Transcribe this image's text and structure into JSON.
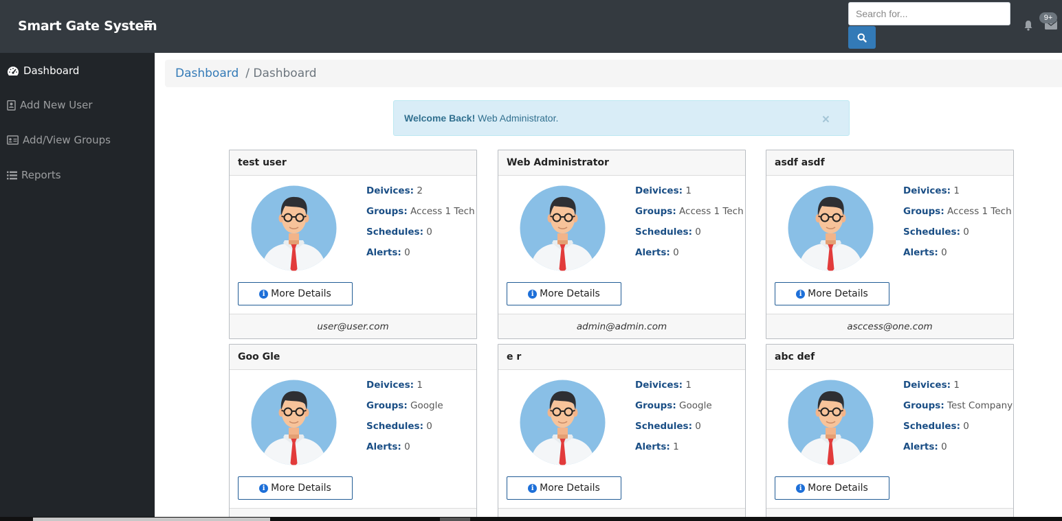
{
  "app": {
    "brand": "Smart Gate System",
    "menu_icon": "bars-icon"
  },
  "topbar": {
    "search_placeholder": "Search for...",
    "search_icon": "search-icon",
    "notification_icon": "bell-icon",
    "message_icon": "envelope-icon",
    "message_badge": "9+"
  },
  "sidebar": {
    "items": [
      {
        "label": "Dashboard",
        "icon": "tachometer-icon",
        "active": true
      },
      {
        "label": "Add New User",
        "icon": "address-book-icon",
        "active": false
      },
      {
        "label": "Add/View Groups",
        "icon": "id-card-icon",
        "active": false
      },
      {
        "label": "Reports",
        "icon": "list-icon",
        "active": false
      }
    ]
  },
  "breadcrumb": {
    "link": "Dashboard",
    "current": "/ Dashboard"
  },
  "alert": {
    "strong": "Welcome Back!",
    "message": "Web Administrator.",
    "close": "×"
  },
  "labels": {
    "devices": "Deivices:",
    "groups": "Groups:",
    "schedules": "Schedules:",
    "alerts": "Alerts:",
    "more_details": "More Details"
  },
  "cards": [
    {
      "name": "test user",
      "devices": "2",
      "groups": "Access 1 Tech",
      "schedules": "0",
      "alerts": "0",
      "email": "user@user.com"
    },
    {
      "name": "Web Administrator",
      "devices": "1",
      "groups": "Access 1 Tech",
      "schedules": "0",
      "alerts": "0",
      "email": "admin@admin.com"
    },
    {
      "name": "asdf asdf",
      "devices": "1",
      "groups": "Access 1 Tech",
      "schedules": "0",
      "alerts": "0",
      "email": "asccess@one.com"
    },
    {
      "name": "Goo Gle",
      "devices": "1",
      "groups": "Google",
      "schedules": "0",
      "alerts": "0",
      "email": ""
    },
    {
      "name": "e r",
      "devices": "1",
      "groups": "Google",
      "schedules": "0",
      "alerts": "1",
      "email": ""
    },
    {
      "name": "abc def",
      "devices": "1",
      "groups": "Test Company",
      "schedules": "0",
      "alerts": "0",
      "email": ""
    }
  ],
  "colors": {
    "navbar": "#343a40",
    "sidebar": "#212529",
    "primary": "#337ab7",
    "alert_bg": "#d9edf7",
    "label_blue": "#1a4e85"
  }
}
